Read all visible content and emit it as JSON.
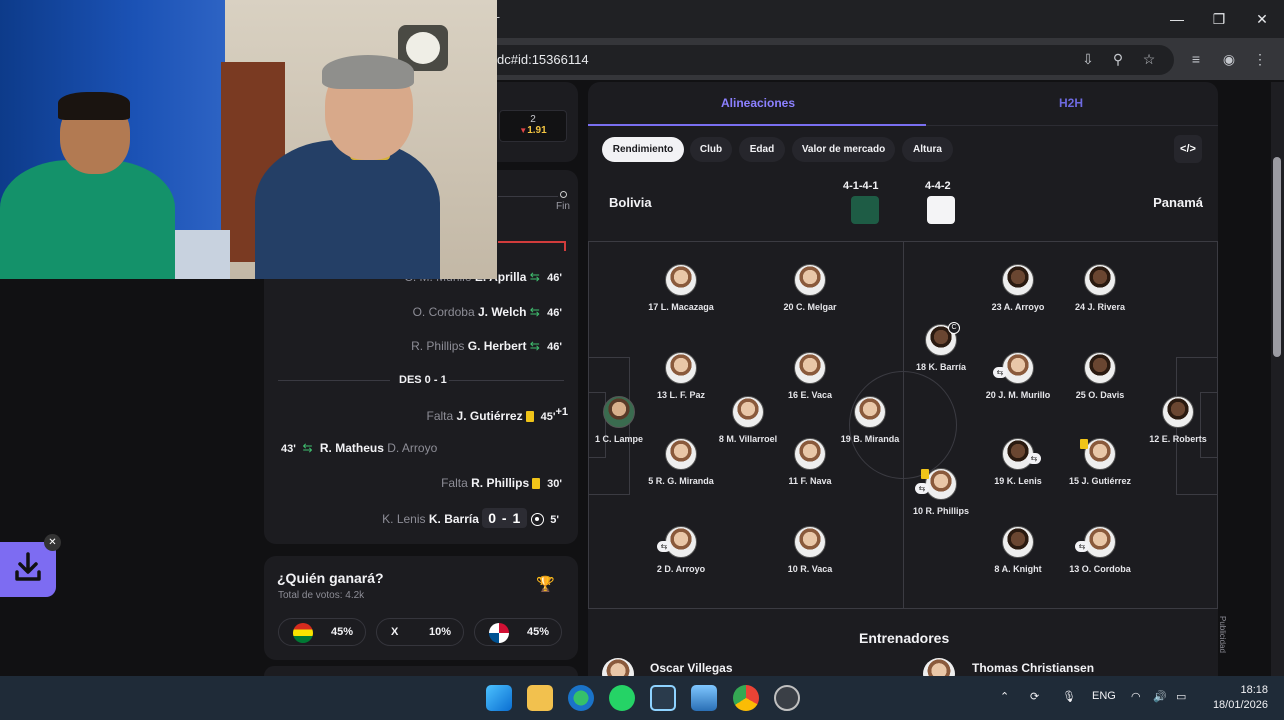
{
  "browser": {
    "url": "dc#id:15366114",
    "newtab": "+",
    "window_controls": {
      "minimize": "—",
      "maximize": "❐",
      "close": "✕"
    }
  },
  "score_box": {
    "top": "2",
    "odds": "1.91"
  },
  "timeline": {
    "fin": "Fin"
  },
  "events": [
    {
      "out": "C. M. Murillo",
      "in": "E. Aprilla",
      "min": "46'"
    },
    {
      "out": "O. Cordoba",
      "in": "J. Welch",
      "min": "46'"
    },
    {
      "out": "R. Phillips",
      "in": "G. Herbert",
      "min": "46'"
    },
    {
      "divider": "DES 0 - 1"
    },
    {
      "label": "Falta",
      "player": "J. Gutiérrez",
      "min": "45'",
      "extra": "+1"
    },
    {
      "min": "43'",
      "in": "R. Matheus",
      "out": "D. Arroyo"
    },
    {
      "label": "Falta",
      "player": "R. Phillips",
      "min": "30'"
    },
    {
      "out": "K. Lenis",
      "in": "K. Barría",
      "score": "0 - 1",
      "min": "5'"
    }
  ],
  "poll": {
    "title": "¿Quién ganará?",
    "subtitle": "Total de votos: 4.2k",
    "options": [
      {
        "flag": "bolivia",
        "pct": "45%"
      },
      {
        "label": "X",
        "pct": "10%"
      },
      {
        "flag": "panama",
        "pct": "45%"
      }
    ]
  },
  "lineups": {
    "tabs": [
      "Alineaciones",
      "H2H"
    ],
    "chips": [
      "Rendimiento",
      "Club",
      "Edad",
      "Valor de mercado",
      "Altura"
    ],
    "code_btn": "</>",
    "home": {
      "name": "Bolivia",
      "formation": "4-1-4-1",
      "color": "#1e5c45"
    },
    "away": {
      "name": "Panamá",
      "formation": "4-4-2",
      "color": "#f4f4f6"
    },
    "home_players": [
      {
        "label": "1 C. Lampe",
        "kind": "gk-home"
      },
      {
        "label": "17 L. Macazaga"
      },
      {
        "label": "13 L. F. Paz"
      },
      {
        "label": "5 R. G. Miranda"
      },
      {
        "label": "2 D. Arroyo",
        "badge": "s"
      },
      {
        "label": "8 M. Villarroel"
      },
      {
        "label": "20 C. Melgar"
      },
      {
        "label": "16 E. Vaca"
      },
      {
        "label": "11 F. Nava"
      },
      {
        "label": "10 R. Vaca"
      },
      {
        "label": "19 B. Miranda"
      }
    ],
    "away_players": [
      {
        "label": "12 E. Roberts",
        "kind": "dark"
      },
      {
        "label": "23 A. Arroyo",
        "kind": "dark"
      },
      {
        "label": "20 J. M. Murillo",
        "badge": "s"
      },
      {
        "label": "19 K. Lenis",
        "kind": "dark",
        "badge": "s"
      },
      {
        "label": "8 A. Knight",
        "kind": "dark"
      },
      {
        "label": "24 J. Rivera",
        "kind": "dark"
      },
      {
        "label": "25 O. Davis",
        "kind": "dark"
      },
      {
        "label": "15 J. Gutiérrez",
        "badge": "y"
      },
      {
        "label": "13 O. Cordoba",
        "badge": "s"
      },
      {
        "label": "18 K. Barría",
        "kind": "dark",
        "badge": "c"
      },
      {
        "label": "10 R. Phillips",
        "badge": "y"
      }
    ],
    "coaches_title": "Entrenadores",
    "coaches": [
      "Oscar Villegas",
      "Thomas Christiansen"
    ],
    "ad_label": "Publicidad"
  },
  "download_widget": {
    "close": "✕"
  },
  "taskbar": {
    "tray": {
      "lang": "ENG",
      "time": "18:18",
      "date": "18/01/2026"
    }
  }
}
